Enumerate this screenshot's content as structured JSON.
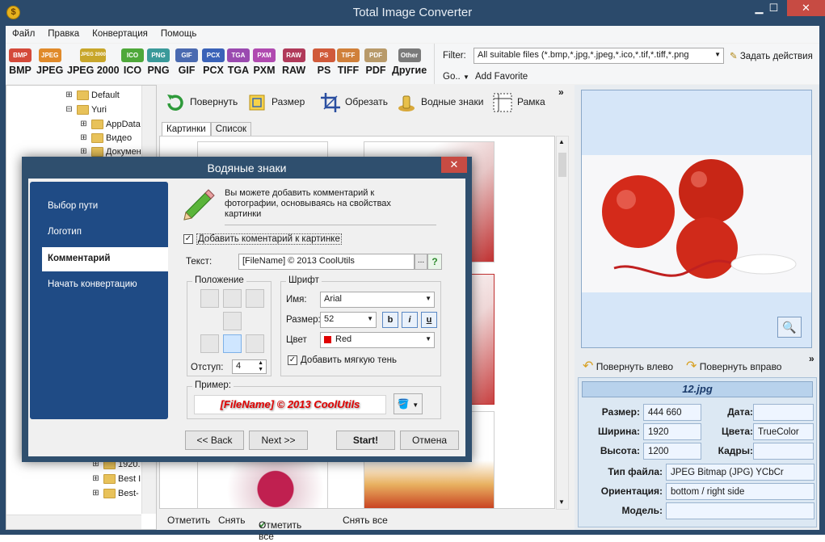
{
  "window": {
    "title": "Total Image Converter",
    "minimize": "▁",
    "maximize": "☐",
    "close": "✕"
  },
  "menu": [
    "Файл",
    "Правка",
    "Конвертация",
    "Помощь"
  ],
  "formats": [
    {
      "label": "BMP",
      "icon": "BMP",
      "color": "#d44a3a"
    },
    {
      "label": "JPEG",
      "icon": "JPEG",
      "color": "#e08a2a"
    },
    {
      "label": "JPEG 2000",
      "icon": "JPEG 2000",
      "color": "#c8a62a"
    },
    {
      "label": "ICO",
      "icon": "ICO",
      "color": "#4ea83a"
    },
    {
      "label": "PNG",
      "icon": "PNG",
      "color": "#3a9a9a"
    },
    {
      "label": "GIF",
      "icon": "GIF",
      "color": "#4a6ab0"
    },
    {
      "label": "PCX",
      "icon": "PCX",
      "color": "#3a62b8"
    },
    {
      "label": "TGA",
      "icon": "TGA",
      "color": "#9a4ab0"
    },
    {
      "label": "PXM",
      "icon": "PXM",
      "color": "#b04ab0"
    },
    {
      "label": "RAW",
      "icon": "RAW",
      "color": "#b03a5a"
    },
    {
      "label": "PS",
      "icon": "PS",
      "color": "#d05a3a"
    },
    {
      "label": "TIFF",
      "icon": "TIFF",
      "color": "#d0803a"
    },
    {
      "label": "PDF",
      "icon": "PDF",
      "color": "#b89a6a"
    },
    {
      "label": "Другие",
      "icon": "Other",
      "color": "#7a7a7a"
    }
  ],
  "filter": {
    "label": "Filter:",
    "value": "All suitable files (*.bmp,*.jpg,*.jpeg,*.ico,*.tif,*.tiff,*.png",
    "tasks": "Задать действия",
    "go": "Go..",
    "add_favorite": "Add Favorite"
  },
  "tree": [
    {
      "label": "Default",
      "expander": "⊞"
    },
    {
      "label": "Yuri",
      "expander": "⊟"
    },
    {
      "label": "AppData",
      "expander": "⊞"
    },
    {
      "label": "Видео",
      "expander": "⊞"
    },
    {
      "label": "Докумен",
      "expander": "⊞"
    },
    {
      "label": "1920.",
      "expander": "⊞"
    },
    {
      "label": "Best I",
      "expander": "⊞"
    },
    {
      "label": "Best-",
      "expander": "⊞"
    }
  ],
  "actions": [
    {
      "label": "Повернуть",
      "icon": "rotate-icon"
    },
    {
      "label": "Размер",
      "icon": "resize-icon"
    },
    {
      "label": "Обрезать",
      "icon": "crop-icon"
    },
    {
      "label": "Водные знаки",
      "icon": "watermark-icon"
    },
    {
      "label": "Рамка",
      "icon": "frame-icon"
    }
  ],
  "more": "»",
  "tabs": [
    "Картинки",
    "Список"
  ],
  "selection": {
    "mark": "Отметить",
    "unmark": "Снять",
    "mark_all": "Отметить все",
    "unmark_all": "Снять все"
  },
  "preview": {
    "rotate_left": "Повернуть влево",
    "rotate_right": "Повернуть вправо"
  },
  "info": {
    "filename": "12.jpg",
    "fields": [
      {
        "label": "Размер:",
        "value": "444 660"
      },
      {
        "label": "Дата:",
        "value": ""
      },
      {
        "label": "Ширина:",
        "value": "1920"
      },
      {
        "label": "Цвета:",
        "value": "TrueColor"
      },
      {
        "label": "Высота:",
        "value": "1200"
      },
      {
        "label": "Кадры:",
        "value": ""
      },
      {
        "label": "Тип файла:",
        "value": "JPEG Bitmap (JPG) YCbCr"
      },
      {
        "label": "Ориентация:",
        "value": "bottom / right side"
      },
      {
        "label": "Модель:",
        "value": ""
      }
    ]
  },
  "dialog": {
    "title": "Водяные знаки",
    "close": "✕",
    "steps": [
      "Выбор пути",
      "Логотип",
      "Комментарий",
      "Начать конвертацию"
    ],
    "active_step": "Комментарий",
    "intro": "Вы можете добавить комментарий к фотографии, основываясь на свойствах картинки",
    "add_comment": "Добавить коментарий к картинке",
    "text_label": "Текст:",
    "text_value": "[FileName] © 2013 CoolUtils",
    "text_more": "...",
    "text_help": "?",
    "position_label": "Положение",
    "indent_label": "Отступ:",
    "indent_value": "4",
    "font_group": "Шрифт",
    "font_name_label": "Имя:",
    "font_name": "Arial",
    "font_size_label": "Размер:",
    "font_size": "52",
    "bold": "b",
    "italic": "i",
    "underline": "u",
    "color_label": "Цвет",
    "color_value": "Red",
    "color_hex": "#e00000",
    "shadow": "Добавить мягкую тень",
    "sample_label": "Пример:",
    "sample_text": "[FileName] © 2013 CoolUtils",
    "back": "<< Back",
    "next": "Next >>",
    "start": "Start!",
    "cancel": "Отмена"
  }
}
